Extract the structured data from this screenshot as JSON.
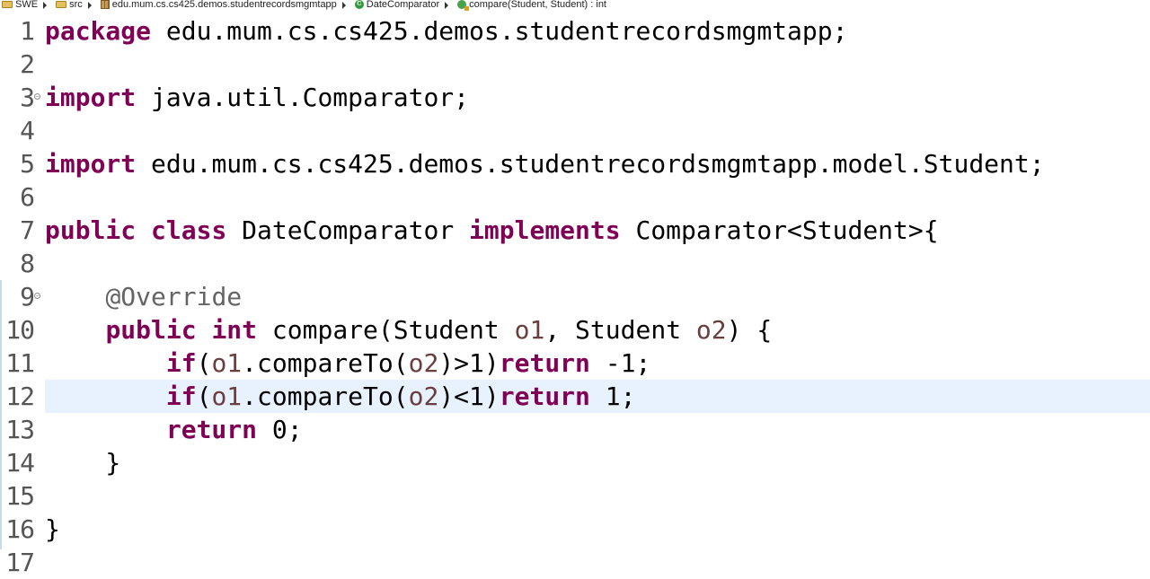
{
  "breadcrumb": {
    "items": [
      {
        "label": "SWE",
        "icon": "project-folder-icon"
      },
      {
        "label": "src",
        "icon": "source-folder-icon"
      },
      {
        "label": "edu.mum.cs.cs425.demos.studentrecordsmgmtapp",
        "icon": "package-icon"
      },
      {
        "label": "DateComparator",
        "icon": "class-icon"
      },
      {
        "label": "compare(Student, Student) : int",
        "icon": "method-icon"
      }
    ]
  },
  "editor": {
    "current_line": 12,
    "lines": [
      {
        "n": "1",
        "tokens": [
          [
            "kw",
            "package"
          ],
          [
            "t",
            " edu.mum.cs.cs425.demos.studentrecordsmgmtapp;"
          ]
        ]
      },
      {
        "n": "2",
        "tokens": []
      },
      {
        "n": "3",
        "fold": true,
        "tokens": [
          [
            "kw",
            "import"
          ],
          [
            "t",
            " java.util.Comparator;"
          ]
        ]
      },
      {
        "n": "4",
        "tokens": []
      },
      {
        "n": "5",
        "tokens": [
          [
            "kw",
            "import"
          ],
          [
            "t",
            " edu.mum.cs.cs425.demos.studentrecordsmgmtapp.model.Student;"
          ]
        ]
      },
      {
        "n": "6",
        "tokens": []
      },
      {
        "n": "7",
        "tokens": [
          [
            "kw",
            "public"
          ],
          [
            "t",
            " "
          ],
          [
            "kw",
            "class"
          ],
          [
            "t",
            " DateComparator "
          ],
          [
            "kw",
            "implements"
          ],
          [
            "t",
            " Comparator<Student>{"
          ]
        ]
      },
      {
        "n": "8",
        "tokens": []
      },
      {
        "n": "9",
        "fold": true,
        "tokens": [
          [
            "t",
            "    "
          ],
          [
            "ann",
            "@Override"
          ]
        ]
      },
      {
        "n": "10",
        "tokens": [
          [
            "t",
            "    "
          ],
          [
            "kw",
            "public"
          ],
          [
            "t",
            " "
          ],
          [
            "kw",
            "int"
          ],
          [
            "t",
            " compare(Student "
          ],
          [
            "var",
            "o1"
          ],
          [
            "t",
            ", Student "
          ],
          [
            "var",
            "o2"
          ],
          [
            "t",
            ") {"
          ]
        ]
      },
      {
        "n": "11",
        "tokens": [
          [
            "t",
            "        "
          ],
          [
            "kw",
            "if"
          ],
          [
            "t",
            "("
          ],
          [
            "var",
            "o1"
          ],
          [
            "t",
            ".compareTo("
          ],
          [
            "var",
            "o2"
          ],
          [
            "t",
            ")>1)"
          ],
          [
            "kw",
            "return"
          ],
          [
            "t",
            " -1;"
          ]
        ]
      },
      {
        "n": "12",
        "tokens": [
          [
            "t",
            "        "
          ],
          [
            "kw",
            "if"
          ],
          [
            "t",
            "("
          ],
          [
            "var",
            "o1"
          ],
          [
            "t",
            ".compareTo("
          ],
          [
            "var",
            "o2"
          ],
          [
            "t",
            ")<1)"
          ],
          [
            "kw",
            "return"
          ],
          [
            "t",
            " 1;"
          ]
        ]
      },
      {
        "n": "13",
        "tokens": [
          [
            "t",
            "        "
          ],
          [
            "kw",
            "return"
          ],
          [
            "t",
            " 0;"
          ]
        ]
      },
      {
        "n": "14",
        "tokens": [
          [
            "t",
            "    }"
          ]
        ]
      },
      {
        "n": "15",
        "tokens": []
      },
      {
        "n": "16",
        "tokens": [
          [
            "t",
            "}"
          ]
        ]
      },
      {
        "n": "17",
        "tokens": []
      }
    ]
  }
}
